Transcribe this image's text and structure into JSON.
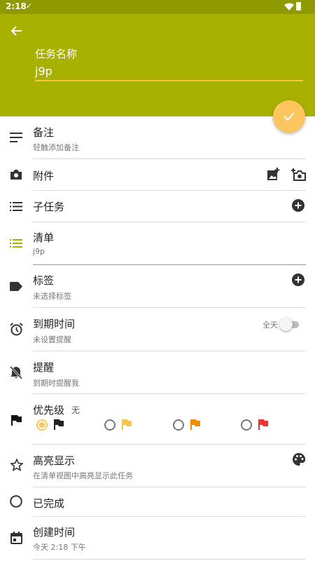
{
  "status_bar": {
    "time": "2:18",
    "check": "✓"
  },
  "header": {
    "name_label": "任务名称",
    "name_value": "j9p"
  },
  "colors": {
    "header": "#a8b000",
    "accent": "#fcc55e",
    "list_icon": "#a8b000"
  },
  "rows": {
    "notes": {
      "title": "备注",
      "sub": "轻触添加备注"
    },
    "attachments": {
      "title": "附件"
    },
    "subtasks": {
      "title": "子任务"
    },
    "list": {
      "title": "清单",
      "sub": "j9p"
    },
    "tags": {
      "title": "标签",
      "sub": "未选择标签"
    },
    "due": {
      "title": "到期时间",
      "sub": "未设置提醒",
      "allday": "全天"
    },
    "reminder": {
      "title": "提醒",
      "sub": "到期时提醒我"
    },
    "priority": {
      "title": "优先级",
      "value": "无",
      "options": [
        {
          "name": "none",
          "color": "#222222",
          "selected": true
        },
        {
          "name": "low",
          "color": "#f6c54b",
          "selected": false
        },
        {
          "name": "medium",
          "color": "#f08c00",
          "selected": false
        },
        {
          "name": "high",
          "color": "#e53935",
          "selected": false
        }
      ]
    },
    "highlight": {
      "title": "高亮显示",
      "sub": "在清单视图中高亮显示此任务"
    },
    "completed": {
      "title": "已完成"
    },
    "created": {
      "title": "创建时间",
      "sub": "今天 2:18 下午"
    }
  }
}
